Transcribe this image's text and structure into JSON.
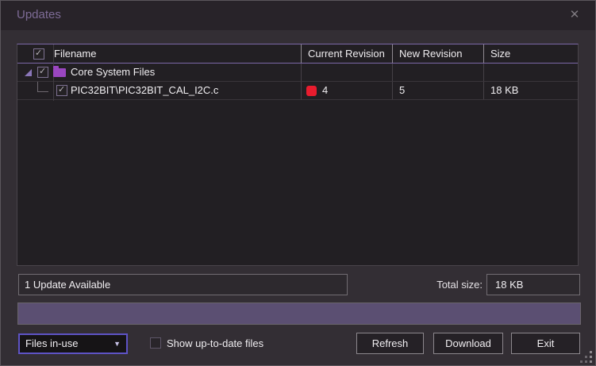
{
  "window": {
    "title": "Updates"
  },
  "icons": {
    "close": "✕",
    "check": "✓",
    "dropdown_arrow": "▼"
  },
  "table": {
    "columns": [
      "Filename",
      "Current Revision",
      "New Revision",
      "Size"
    ],
    "rows": [
      {
        "type": "folder",
        "name": "Core System Files",
        "checked": true,
        "expanded": true,
        "current_revision": "",
        "new_revision": "",
        "size": ""
      },
      {
        "type": "file",
        "name": "PIC32BIT\\PIC32BIT_CAL_I2C.c",
        "checked": true,
        "current_revision": "4",
        "new_revision": "5",
        "size": "18 KB",
        "status_color": "#e81c2e"
      }
    ]
  },
  "status": {
    "updates_text": "1 Update Available",
    "total_size_label": "Total size:",
    "total_size_value": "18 KB"
  },
  "progress": {
    "percent": 100
  },
  "controls": {
    "filter_value": "Files in-use",
    "show_uptodate_label": "Show up-to-date files",
    "show_uptodate_checked": false,
    "buttons": [
      {
        "label": "Refresh"
      },
      {
        "label": "Download"
      },
      {
        "label": "Exit"
      }
    ]
  },
  "colors": {
    "window_bg": "#332e34",
    "titlebar_bg": "#282329",
    "table_bg": "#221f23",
    "accent_purple": "#7b68a8",
    "title_text": "#7d6b96",
    "dropdown_border": "#5e53c5",
    "status_red": "#e81c2e",
    "progress_fill": "#5b4f72",
    "folder_purple": "#9a46c0"
  }
}
